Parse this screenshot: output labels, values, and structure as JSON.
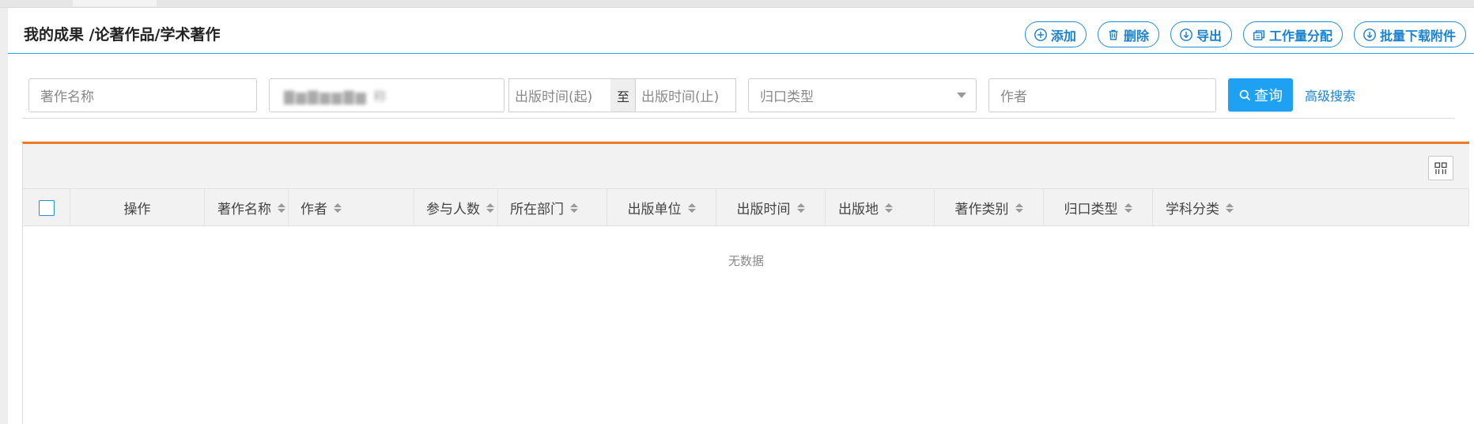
{
  "page_title": "我的成果 /论著作品/学术著作",
  "toolbar": {
    "buttons": [
      {
        "label": "添加",
        "icon": "plus-circle-icon"
      },
      {
        "label": "删除",
        "icon": "trash-icon"
      },
      {
        "label": "导出",
        "icon": "download-circle-icon"
      },
      {
        "label": "工作量分配",
        "icon": "workload-icon"
      },
      {
        "label": "批量下载附件",
        "icon": "download-circle-icon"
      }
    ]
  },
  "filters": {
    "name_placeholder": "著作名称",
    "blurred_value": "▇▆▇▆▆▇▆ 称",
    "date_start_placeholder": "出版时间(起)",
    "date_sep": "至",
    "date_end_placeholder": "出版时间(止)",
    "category_placeholder": "归口类型",
    "author_placeholder": "作者",
    "query_label": "查询",
    "advanced_label": "高级搜索"
  },
  "table": {
    "columns": [
      "操作",
      "著作名称",
      "作者",
      "参与人数",
      "所在部门",
      "出版单位",
      "出版时间",
      "出版地",
      "著作类别",
      "归口类型",
      "学科分类"
    ],
    "rows": [],
    "empty_text": "无数据"
  },
  "colors": {
    "accent": "#1ea1f2",
    "link": "#1a82d0",
    "table_top_border": "#f07a22"
  }
}
